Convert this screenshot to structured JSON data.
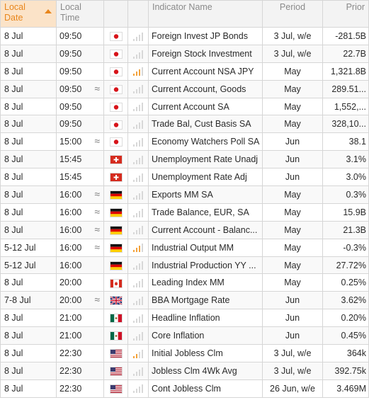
{
  "columns": {
    "local_date": "Local Date",
    "local_time": "Local Time",
    "indicator_name": "Indicator Name",
    "period": "Period",
    "prior": "Prior"
  },
  "colors": {
    "sorted_header_bg": "#fbe3c8",
    "sorted_header_text": "#e8861c",
    "importance_bar": "#f3a23b"
  },
  "rows": [
    {
      "date": "8 Jul",
      "time": "09:50",
      "approx": "",
      "flag": "jp-flag-icon",
      "importance": 0,
      "name": "Foreign Invest JP Bonds",
      "period": "3 Jul, w/e",
      "prior": "-281.5B"
    },
    {
      "date": "8 Jul",
      "time": "09:50",
      "approx": "",
      "flag": "jp-flag-icon",
      "importance": 0,
      "name": "Foreign Stock Investment",
      "period": "3 Jul, w/e",
      "prior": "22.7B"
    },
    {
      "date": "8 Jul",
      "time": "09:50",
      "approx": "",
      "flag": "jp-flag-icon",
      "importance": 3,
      "name": "Current Account NSA JPY",
      "period": "May",
      "prior": "1,321.8B"
    },
    {
      "date": "8 Jul",
      "time": "09:50",
      "approx": "≈",
      "flag": "jp-flag-icon",
      "importance": 0,
      "name": "Current Account, Goods",
      "period": "May",
      "prior": "289.51..."
    },
    {
      "date": "8 Jul",
      "time": "09:50",
      "approx": "",
      "flag": "jp-flag-icon",
      "importance": 0,
      "name": "Current Account SA",
      "period": "May",
      "prior": "1,552,..."
    },
    {
      "date": "8 Jul",
      "time": "09:50",
      "approx": "",
      "flag": "jp-flag-icon",
      "importance": 0,
      "name": "Trade Bal, Cust Basis SA",
      "period": "May",
      "prior": "328,10..."
    },
    {
      "date": "8 Jul",
      "time": "15:00",
      "approx": "≈",
      "flag": "jp-flag-icon",
      "importance": 0,
      "name": "Economy Watchers Poll SA",
      "period": "Jun",
      "prior": "38.1"
    },
    {
      "date": "8 Jul",
      "time": "15:45",
      "approx": "",
      "flag": "ch-flag-icon",
      "importance": 0,
      "name": "Unemployment Rate Unadj",
      "period": "Jun",
      "prior": "3.1%"
    },
    {
      "date": "8 Jul",
      "time": "15:45",
      "approx": "",
      "flag": "ch-flag-icon",
      "importance": 0,
      "name": "Unemployment Rate Adj",
      "period": "Jun",
      "prior": "3.0%"
    },
    {
      "date": "8 Jul",
      "time": "16:00",
      "approx": "≈",
      "flag": "de-flag-icon",
      "importance": 0,
      "name": "Exports MM SA",
      "period": "May",
      "prior": "0.3%"
    },
    {
      "date": "8 Jul",
      "time": "16:00",
      "approx": "≈",
      "flag": "de-flag-icon",
      "importance": 0,
      "name": "Trade Balance, EUR, SA",
      "period": "May",
      "prior": "15.9B"
    },
    {
      "date": "8 Jul",
      "time": "16:00",
      "approx": "≈",
      "flag": "de-flag-icon",
      "importance": 0,
      "name": "Current Account - Balanc...",
      "period": "May",
      "prior": "21.3B"
    },
    {
      "date": "5-12 Jul",
      "time": "16:00",
      "approx": "≈",
      "flag": "de-flag-icon",
      "importance": 3,
      "name": "Industrial Output MM",
      "period": "May",
      "prior": "-0.3%"
    },
    {
      "date": "5-12 Jul",
      "time": "16:00",
      "approx": "",
      "flag": "de-flag-icon",
      "importance": 0,
      "name": "Industrial Production YY ...",
      "period": "May",
      "prior": "27.72%"
    },
    {
      "date": "8 Jul",
      "time": "20:00",
      "approx": "",
      "flag": "ca-flag-icon",
      "importance": 0,
      "name": "Leading Index MM",
      "period": "May",
      "prior": "0.25%"
    },
    {
      "date": "7-8 Jul",
      "time": "20:00",
      "approx": "≈",
      "flag": "gb-flag-icon",
      "importance": 0,
      "name": "BBA Mortgage Rate",
      "period": "Jun",
      "prior": "3.62%"
    },
    {
      "date": "8 Jul",
      "time": "21:00",
      "approx": "",
      "flag": "mx-flag-icon",
      "importance": 0,
      "name": "Headline Inflation",
      "period": "Jun",
      "prior": "0.20%"
    },
    {
      "date": "8 Jul",
      "time": "21:00",
      "approx": "",
      "flag": "mx-flag-icon",
      "importance": 0,
      "name": "Core Inflation",
      "period": "Jun",
      "prior": "0.45%"
    },
    {
      "date": "8 Jul",
      "time": "22:30",
      "approx": "",
      "flag": "us-flag-icon",
      "importance": 2,
      "name": "Initial Jobless Clm",
      "period": "3 Jul, w/e",
      "prior": "364k"
    },
    {
      "date": "8 Jul",
      "time": "22:30",
      "approx": "",
      "flag": "us-flag-icon",
      "importance": 0,
      "name": "Jobless Clm 4Wk Avg",
      "period": "3 Jul, w/e",
      "prior": "392.75k"
    },
    {
      "date": "8 Jul",
      "time": "22:30",
      "approx": "",
      "flag": "us-flag-icon",
      "importance": 0,
      "name": "Cont Jobless Clm",
      "period": "26 Jun, w/e",
      "prior": "3.469M"
    }
  ]
}
